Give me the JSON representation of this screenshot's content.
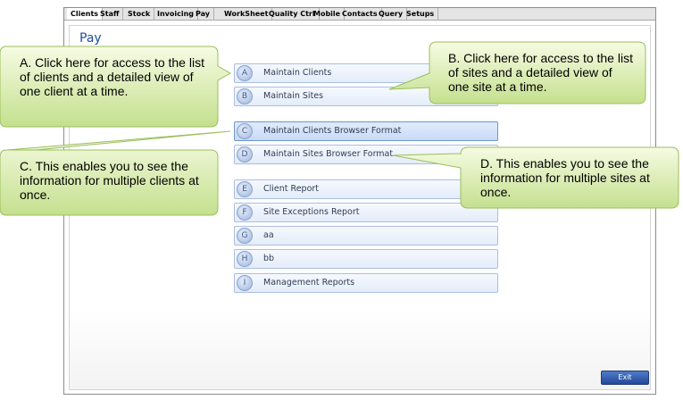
{
  "tabs": [
    {
      "label": "Clients",
      "active": true
    },
    {
      "label": "Staff",
      "active": false
    },
    {
      "label": "Stock",
      "active": false
    },
    {
      "label": "Invoicing",
      "active": false
    },
    {
      "label": "Pay",
      "active": false
    },
    {
      "label": "WorkSheet",
      "active": false
    },
    {
      "label": "Quality Ctrl",
      "active": false
    },
    {
      "label": "Mobile",
      "active": false
    },
    {
      "label": "Contacts",
      "active": false
    },
    {
      "label": "Query",
      "active": false
    },
    {
      "label": "Setups",
      "active": false
    }
  ],
  "page": {
    "title": "Pay"
  },
  "menu": [
    {
      "letter": "A",
      "label": "Maintain Clients"
    },
    {
      "letter": "B",
      "label": "Maintain Sites"
    },
    {
      "letter": "C",
      "label": "Maintain Clients Browser Format",
      "selected": true
    },
    {
      "letter": "D",
      "label": "Maintain Sites Browser Format"
    },
    {
      "letter": "E",
      "label": "Client Report"
    },
    {
      "letter": "F",
      "label": "Site Exceptions Report"
    },
    {
      "letter": "G",
      "label": "aa"
    },
    {
      "letter": "H",
      "label": "bb"
    },
    {
      "letter": "I",
      "label": "Management Reports"
    }
  ],
  "exit_label": "Exit",
  "callouts": {
    "a": "A. Click here for access to the list of clients and a detailed view of one client at a time.",
    "b": "B. Click here for access to the list of sites and a detailed view of one site at a time.",
    "c": "C. This enables you to see the information for multiple clients at once.",
    "d": "D. This enables you to see the information for multiple sites at once."
  },
  "colors": {
    "callout_fill_top": "#f6fbe3",
    "callout_fill_bottom": "#c4e08e",
    "callout_border": "#9bbf5c",
    "title_blue": "#1f4e9e",
    "exit_button": "#23489a"
  }
}
